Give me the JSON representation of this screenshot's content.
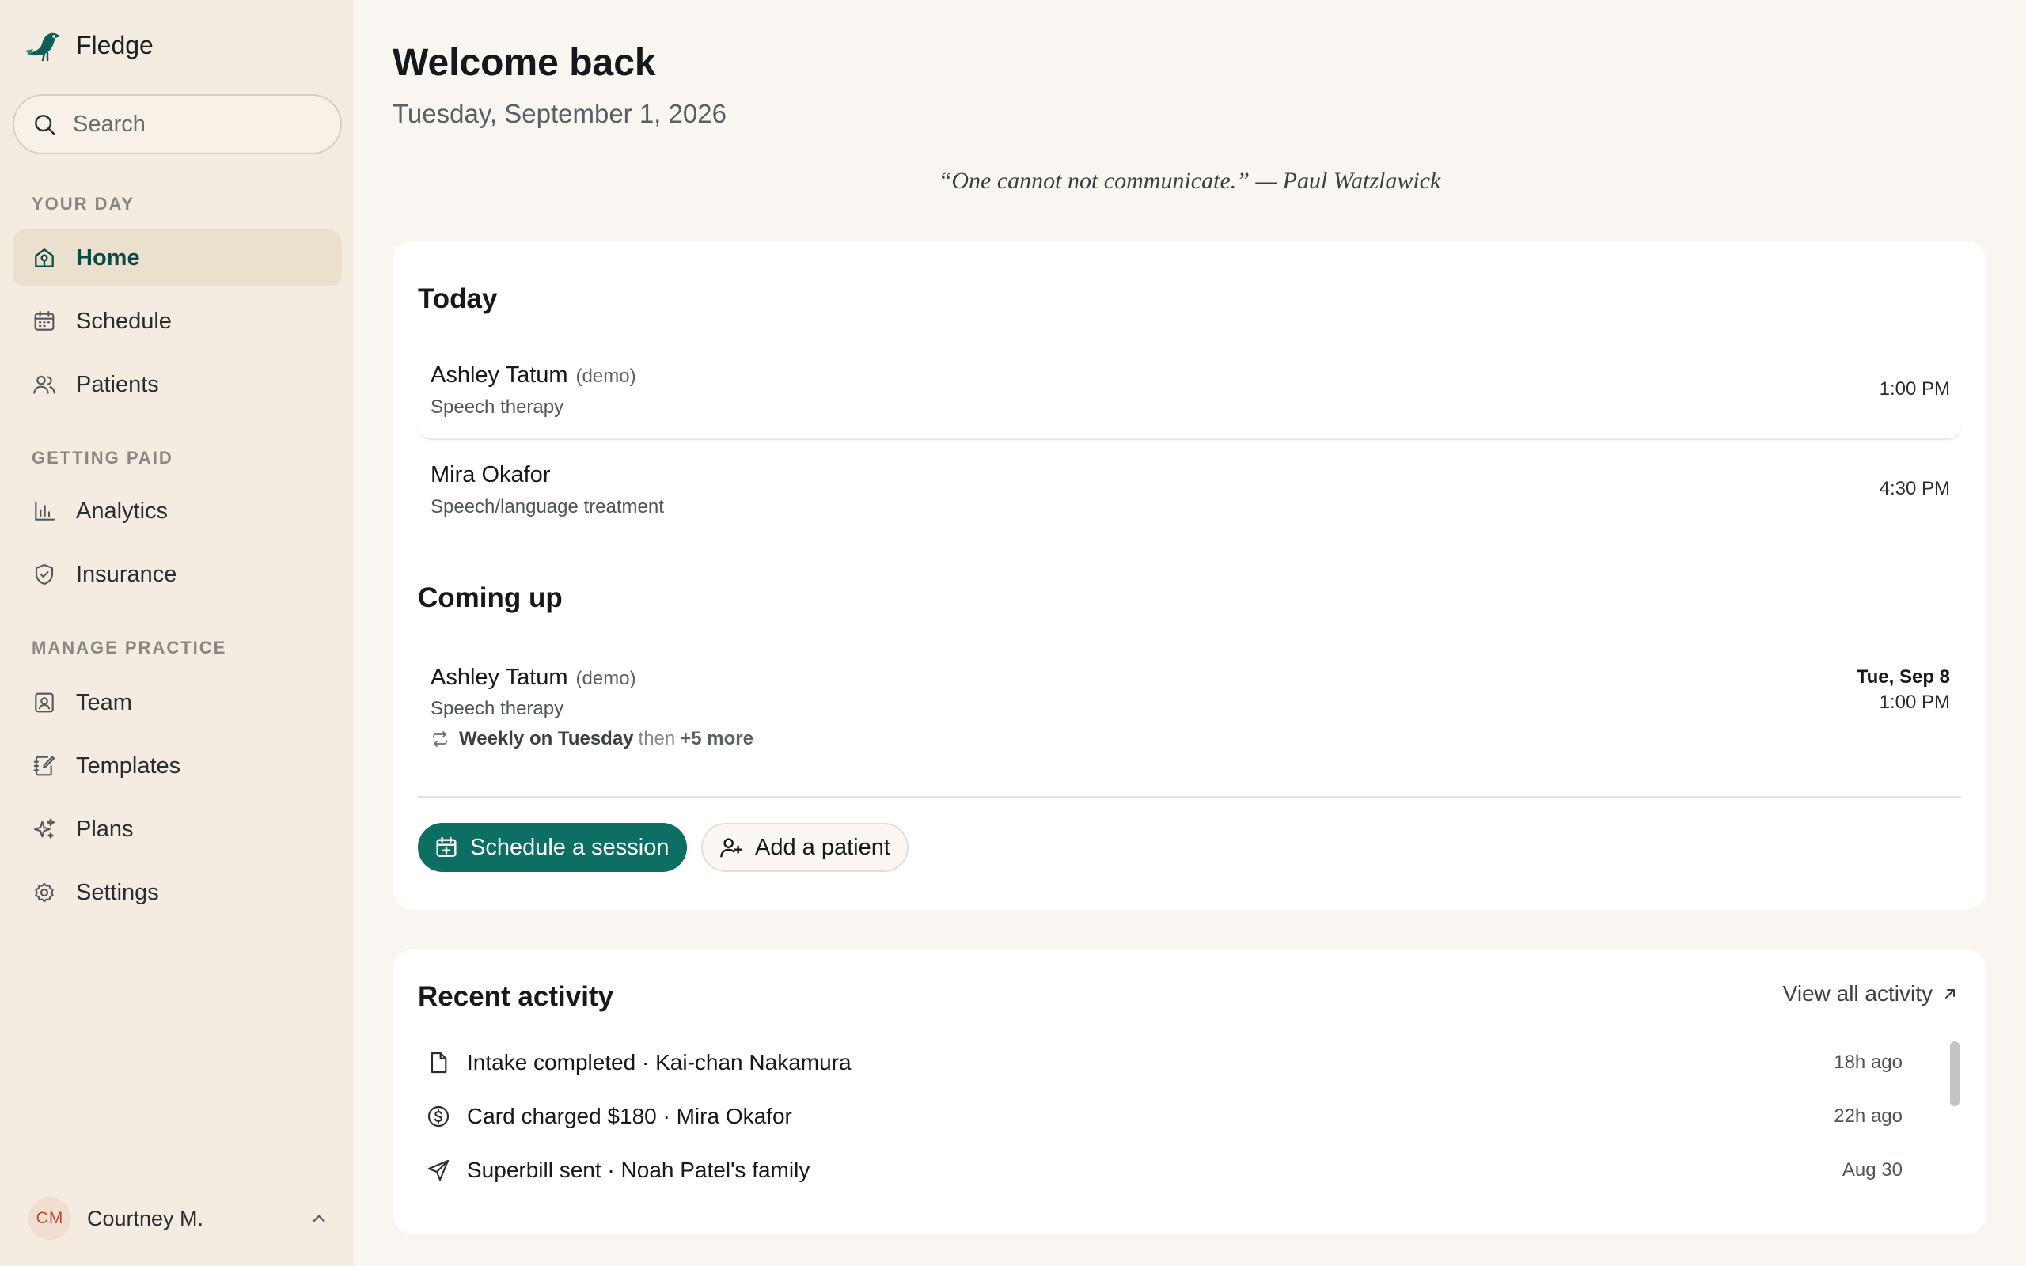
{
  "app": {
    "name": "Fledge"
  },
  "search": {
    "placeholder": "Search"
  },
  "sidebar": {
    "sections": [
      {
        "label": "YOUR DAY"
      },
      {
        "label": "GETTING PAID"
      },
      {
        "label": "MANAGE PRACTICE"
      }
    ],
    "items": [
      {
        "label": "Home",
        "icon": "home-icon",
        "active": true
      },
      {
        "label": "Schedule",
        "icon": "calendar-icon"
      },
      {
        "label": "Patients",
        "icon": "users-icon"
      },
      {
        "label": "Analytics",
        "icon": "bar-chart-icon"
      },
      {
        "label": "Insurance",
        "icon": "shield-check-icon"
      },
      {
        "label": "Team",
        "icon": "id-badge-icon"
      },
      {
        "label": "Templates",
        "icon": "notebook-edit-icon"
      },
      {
        "label": "Plans",
        "icon": "sparkles-icon"
      },
      {
        "label": "Settings",
        "icon": "gear-icon"
      }
    ]
  },
  "user": {
    "initials": "CM",
    "name": "Courtney M."
  },
  "header": {
    "title": "Welcome back",
    "date": "Tuesday, September 1, 2026",
    "quote": "“One cannot not communicate.” — Paul Watzlawick"
  },
  "today": {
    "heading": "Today",
    "appointments": [
      {
        "name": "Ashley Tatum",
        "tag": "(demo)",
        "type": "Speech therapy",
        "time": "1:00 PM"
      },
      {
        "name": "Mira Okafor",
        "tag": "",
        "type": "Speech/language treatment",
        "time": "4:30 PM"
      }
    ]
  },
  "coming_up": {
    "heading": "Coming up",
    "appointments": [
      {
        "name": "Ashley Tatum",
        "tag": "(demo)",
        "type": "Speech therapy",
        "recurrence": "Weekly on Tuesday",
        "recurrence_then": "then",
        "recurrence_more": "+5 more",
        "date": "Tue, Sep 8",
        "time": "1:00 PM"
      }
    ]
  },
  "actions": {
    "schedule_label": "Schedule a session",
    "add_patient_label": "Add a patient"
  },
  "activity": {
    "heading": "Recent activity",
    "view_all_label": "View all activity",
    "items": [
      {
        "icon": "document-icon",
        "text": "Intake completed · Kai-chan Nakamura",
        "time": "18h ago"
      },
      {
        "icon": "dollar-circle-icon",
        "text": "Card charged $180 · Mira Okafor",
        "time": "22h ago"
      },
      {
        "icon": "send-icon",
        "text": "Superbill sent · Noah Patel's family",
        "time": "Aug 30"
      }
    ]
  },
  "colors": {
    "sidebar_bg": "#f4ece0",
    "page_bg": "#f9f6f1",
    "accent": "#0d6e64",
    "active_nav_bg": "#ebdfcd"
  }
}
